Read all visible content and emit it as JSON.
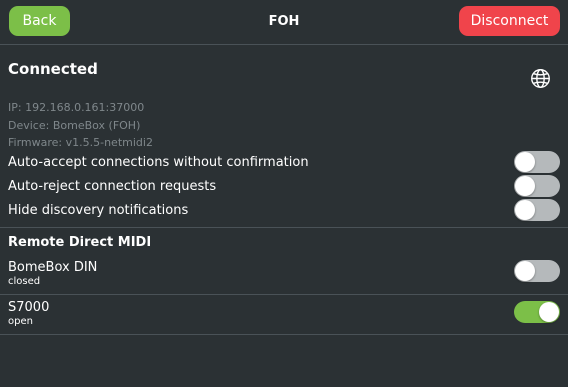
{
  "header": {
    "back_label": "Back",
    "title": "FOH",
    "disconnect_label": "Disconnect"
  },
  "status": {
    "title": "Connected",
    "ip": "IP: 192.168.0.161:37000",
    "device": "Device: BomeBox (FOH)",
    "firmware": "Firmware: v1.5.5-netmidi2",
    "globe_icon": "globe-icon"
  },
  "options": [
    {
      "label": "Auto-accept connections without confirmation",
      "enabled": false
    },
    {
      "label": "Auto-reject connection requests",
      "enabled": false
    },
    {
      "label": "Hide discovery notifications",
      "enabled": false
    }
  ],
  "remote_midi": {
    "title": "Remote Direct MIDI",
    "devices": [
      {
        "name": "BomeBox DIN",
        "status": "closed",
        "enabled": false
      },
      {
        "name": "S7000",
        "status": "open",
        "enabled": true
      }
    ]
  },
  "colors": {
    "background": "#2b3134",
    "accent_green": "#7cbf48",
    "danger_red": "#f0444b",
    "toggle_off": "#b5b9bb",
    "muted_text": "#7f878b"
  }
}
